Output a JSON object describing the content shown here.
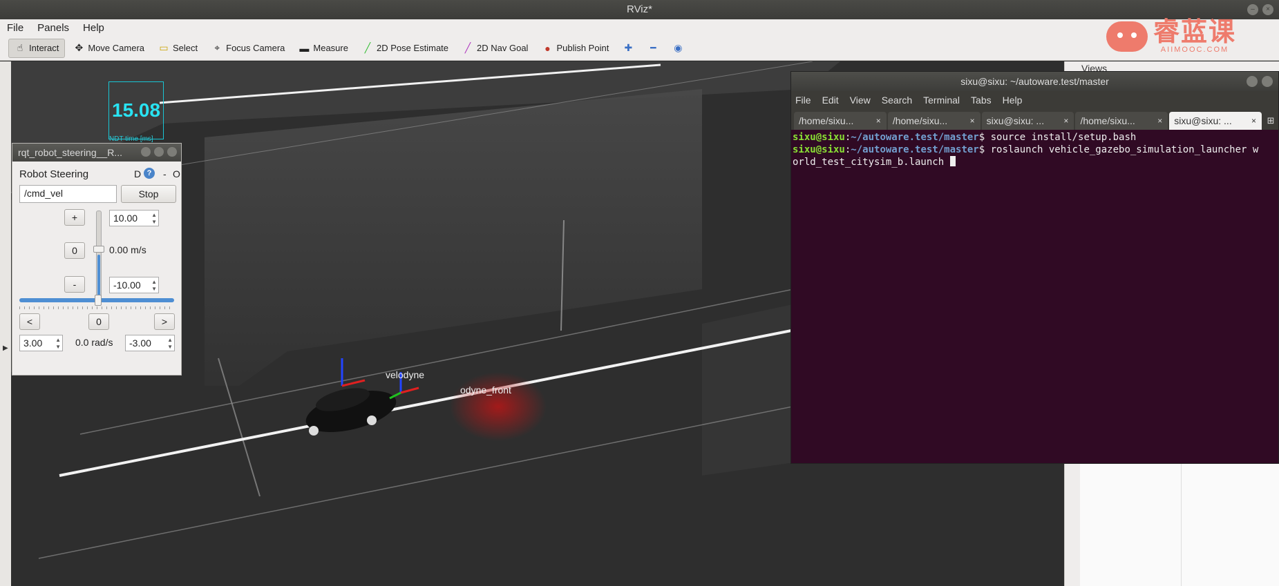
{
  "window": {
    "title": "RViz*"
  },
  "menubar": {
    "items": [
      "File",
      "Panels",
      "Help"
    ]
  },
  "toolbar": {
    "tools": [
      {
        "label": "Interact",
        "icon": "hand-icon"
      },
      {
        "label": "Move Camera",
        "icon": "move-camera-icon"
      },
      {
        "label": "Select",
        "icon": "select-icon"
      },
      {
        "label": "Focus Camera",
        "icon": "focus-camera-icon"
      },
      {
        "label": "Measure",
        "icon": "measure-icon"
      },
      {
        "label": "2D Pose Estimate",
        "icon": "pose-estimate-icon"
      },
      {
        "label": "2D Nav Goal",
        "icon": "nav-goal-icon"
      },
      {
        "label": "Publish Point",
        "icon": "publish-point-icon"
      }
    ]
  },
  "watermark": {
    "text": "睿蓝课",
    "sub": "AIIMOOC.COM"
  },
  "right_panel": {
    "title": "Views"
  },
  "ndt": {
    "value": "15.08",
    "label": "NDT time [ms]"
  },
  "rqt": {
    "window_title": "rqt_robot_steering__R...",
    "heading": "Robot Steering",
    "d_label": "D",
    "help": "?",
    "minus": "-",
    "close": "O",
    "topic": "/cmd_vel",
    "stop_label": "Stop",
    "plus_label": "+",
    "zero_label": "0",
    "minus_label": "-",
    "max_linear": "10.00",
    "min_linear": "-10.00",
    "linear_readout": "0.00 m/s",
    "left_label": "<",
    "center_label": "0",
    "right_label": ">",
    "max_angular": "3.00",
    "min_angular": "-3.00",
    "angular_readout": "0.0 rad/s",
    "linear_level": 0.5,
    "angular_level": 0.5
  },
  "scene": {
    "label_velodyne": "velodyne",
    "label_velodyne_front": "odyne_front"
  },
  "terminal": {
    "title": "sixu@sixu: ~/autoware.test/master",
    "menu": [
      "File",
      "Edit",
      "View",
      "Search",
      "Terminal",
      "Tabs",
      "Help"
    ],
    "tabs": [
      {
        "label": "/home/sixu...",
        "active": false
      },
      {
        "label": "/home/sixu...",
        "active": false
      },
      {
        "label": "sixu@sixu: ...",
        "active": false
      },
      {
        "label": "/home/sixu...",
        "active": false
      },
      {
        "label": "sixu@sixu: ...",
        "active": true
      }
    ],
    "lines": [
      {
        "user": "sixu@sixu",
        "path": "~/autoware.test/master",
        "cmd": "source install/setup.bash"
      },
      {
        "user": "sixu@sixu",
        "path": "~/autoware.test/master",
        "cmd": "roslaunch vehicle_gazebo_simulation_launcher w"
      }
    ],
    "continuation": "orld_test_citysim_b.launch "
  }
}
